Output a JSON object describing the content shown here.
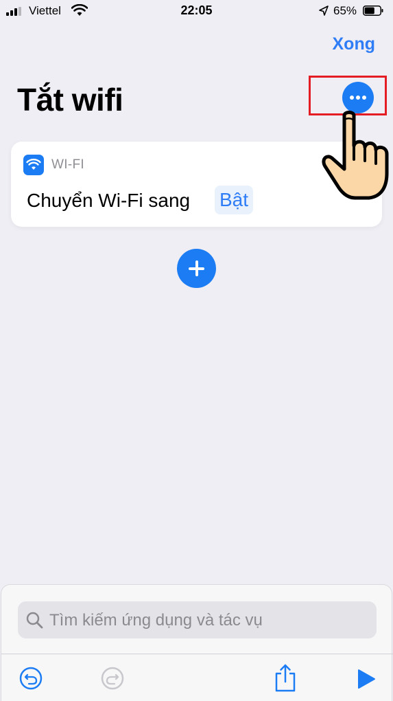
{
  "status_bar": {
    "carrier": "Viettel",
    "time": "22:05",
    "battery_percent": "65%",
    "battery_level": 0.65
  },
  "header": {
    "done_label": "Xong",
    "title": "Tắt wifi"
  },
  "action": {
    "category": "WI-FI",
    "text": "Chuyển Wi-Fi sang",
    "parameter": "Bật"
  },
  "search": {
    "placeholder": "Tìm kiếm ứng dụng và tác vụ"
  },
  "icons": {
    "more": "ellipsis-icon",
    "add": "plus-icon",
    "wifi": "wifi-icon",
    "undo": "undo-icon",
    "redo": "redo-icon",
    "share": "share-icon",
    "run": "play-icon",
    "pointer": "pointing-hand-icon"
  },
  "colors": {
    "accent": "#1c7cf3",
    "highlight": "#e41c24",
    "background": "#efeef4"
  }
}
